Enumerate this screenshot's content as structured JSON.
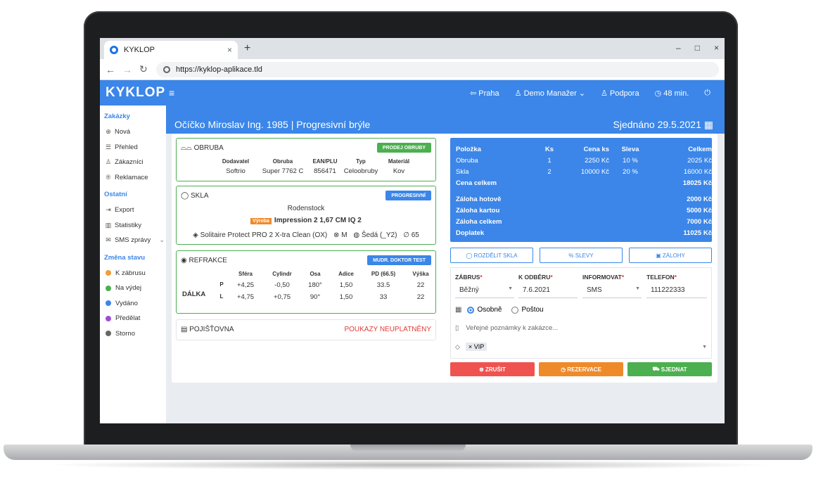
{
  "browser": {
    "tab_title": "KYKLOP",
    "tab_close": "×",
    "new_tab": "+",
    "url": "https://kyklop-aplikace.tld",
    "controls": [
      "–",
      "□",
      "×"
    ]
  },
  "header": {
    "logo": "KYKLOP",
    "lang": "Praha",
    "user": "Demo Manažer",
    "support": "Podpora",
    "timer": "48 min."
  },
  "sidebar": {
    "orders_title": "Zakázky",
    "orders": [
      {
        "label": "Nová",
        "icon": "plus-circle-icon"
      },
      {
        "label": "Přehled",
        "icon": "list-icon"
      },
      {
        "label": "Zákazníci",
        "icon": "users-icon"
      },
      {
        "label": "Reklamace",
        "icon": "return-icon"
      }
    ],
    "other_title": "Ostatní",
    "other": [
      {
        "label": "Export",
        "icon": "export-icon"
      },
      {
        "label": "Statistiky",
        "icon": "chart-icon"
      },
      {
        "label": "SMS zprávy",
        "icon": "sms-icon"
      }
    ],
    "status_title": "Změna stavu",
    "statuses": [
      {
        "label": "K zábrusu",
        "color": "#f29c38"
      },
      {
        "label": "Na výdej",
        "color": "#4caf50"
      },
      {
        "label": "Vydáno",
        "color": "#3b86e8"
      },
      {
        "label": "Předělat",
        "color": "#9c4fd6"
      },
      {
        "label": "Storno",
        "color": "#666666"
      }
    ]
  },
  "page": {
    "title": "Očíčko Miroslav Ing. 1985 | Progresivní brýle",
    "arranged": "Sjednáno 29.5.2021"
  },
  "frame": {
    "title": "OBRUBA",
    "button": "PRODEJ OBRUBY",
    "headers": [
      "Dodavatel",
      "Obruba",
      "EAN/PLU",
      "Typ",
      "Materiál"
    ],
    "values": [
      "Softrio",
      "Super 7762 C",
      "856471",
      "Celoobruby",
      "Kov"
    ]
  },
  "lenses": {
    "title": "SKLA",
    "button": "PROGRESIVNÍ",
    "brand": "Rodenstock",
    "badge": "Výroba",
    "product": "Impression 2 1,67 CM IQ 2",
    "coating": "Solitaire Protect PRO 2 X-tra Clean (OX)",
    "size": "M",
    "tint": "Šedá (_Y2)",
    "diameter": "65"
  },
  "refraction": {
    "title": "REFRAKCE",
    "button": "MUDR. DOKTOR TEST",
    "headers": [
      "Sféra",
      "Cylindr",
      "Osa",
      "Adice",
      "PD (66.5)",
      "Výška"
    ],
    "row_label": "DÁLKA",
    "rows": [
      {
        "side": "P",
        "values": [
          "+4,25",
          "-0,50",
          "180°",
          "1,50",
          "33.5",
          "22"
        ]
      },
      {
        "side": "L",
        "values": [
          "+4,75",
          "+0,75",
          "90°",
          "1,50",
          "33",
          "22"
        ]
      }
    ]
  },
  "insurance": {
    "title": "POJIŠŤOVNA",
    "status": "POUKAZY NEUPLATNĚNY"
  },
  "summary": {
    "headers": [
      "Položka",
      "Ks",
      "Cena ks",
      "Sleva",
      "Celkem"
    ],
    "rows": [
      [
        "Obruba",
        "1",
        "2250 Kč",
        "10 %",
        "2025 Kč"
      ],
      [
        "Skla",
        "2",
        "10000 Kč",
        "20 %",
        "16000 Kč"
      ]
    ],
    "total_label": "Cena celkem",
    "total": "18025 Kč",
    "deposits": [
      {
        "label": "Záloha hotově",
        "value": "2000 Kč"
      },
      {
        "label": "Záloha kartou",
        "value": "5000 Kč"
      },
      {
        "label": "Záloha celkem",
        "value": "7000 Kč"
      },
      {
        "label": "Doplatek",
        "value": "11025 Kč"
      }
    ]
  },
  "actions_top": [
    "ROZDĚLIT SKLA",
    "SLEVY",
    "ZÁLOHY"
  ],
  "form": {
    "grind_label": "ZÁBRUS",
    "grind_value": "Běžný",
    "pickup_label": "K ODBĚRU",
    "pickup_value": "7.6.2021",
    "notify_label": "INFORMOVAT",
    "notify_value": "SMS",
    "phone_label": "TELEFON",
    "phone_value": "111222333",
    "delivery_personal": "Osobně",
    "delivery_post": "Poštou",
    "notes_placeholder": "Veřejné poznámky k zakázce...",
    "tag": "VIP",
    "tag_remove": "×"
  },
  "actions_bottom": [
    {
      "label": "ZRUŠIT",
      "color": "#ef5350"
    },
    {
      "label": "REZERVACE",
      "color": "#ef8a2b"
    },
    {
      "label": "SJEDNAT",
      "color": "#4caf50"
    }
  ]
}
